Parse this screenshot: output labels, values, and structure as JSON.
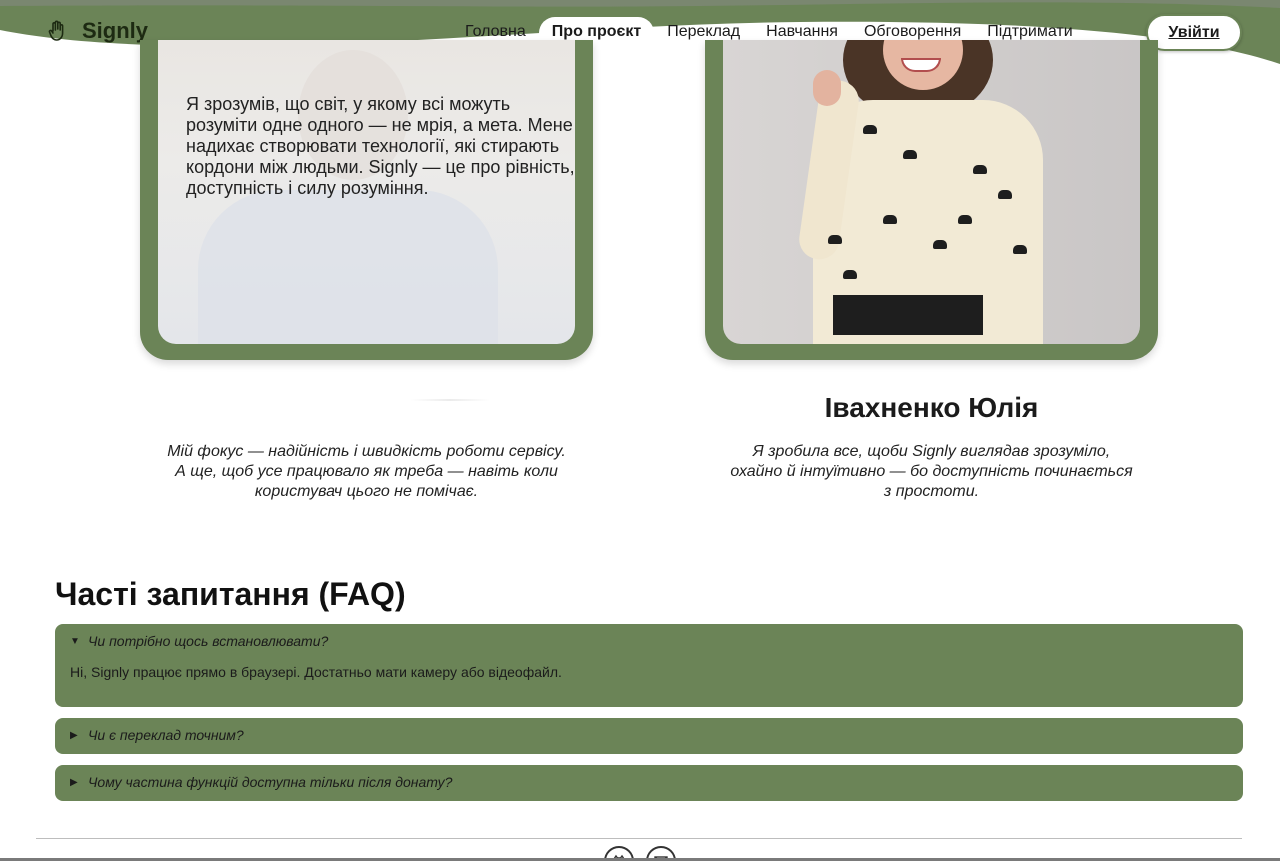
{
  "brand": {
    "name": "Signly",
    "logo_icon": "hand-icon"
  },
  "nav": {
    "items": [
      {
        "label": "Головна"
      },
      {
        "label": "Про проєкт",
        "active": true
      },
      {
        "label": "Переклад"
      },
      {
        "label": "Навчання"
      },
      {
        "label": "Обговорення"
      },
      {
        "label": "Підтримати"
      }
    ],
    "login_label": "Увійти"
  },
  "team": {
    "card1_quote": "Я зрозумів, що світ, у якому всі можуть розуміти одне одного — не мрія, а мета. Мене надихає створювати технології, які стирають кордони між людьми. Signly — це про рівність, доступність і силу розуміння.",
    "member1_quote": "Мій фокус — надійність і швидкість роботи сервісу. А ще, щоб усе працювало як треба — навіть коли користувач цього не помічає.",
    "member2_name": "Івахненко Юлія",
    "member2_quote": "Я зробила все, щоби Signly виглядав зрозуміло, охайно й інтуїтивно — бо доступність починається з простоти."
  },
  "faq": {
    "title": "Часті запитання (FAQ)",
    "items": [
      {
        "question": "Чи потрібно щось встановлювати?",
        "answer": "Ні, Signly працює прямо в браузері. Достатньо мати камеру або відеофайл.",
        "open": true
      },
      {
        "question": "Чи є переклад точним?",
        "open": false
      },
      {
        "question": "Чому частина функцій доступна тільки після донату?",
        "open": false
      }
    ]
  },
  "footer": {
    "icons": [
      "github-icon",
      "mail-icon"
    ]
  },
  "colors": {
    "accent": "#6b8457",
    "text": "#1b1b1b",
    "background": "#ffffff"
  }
}
